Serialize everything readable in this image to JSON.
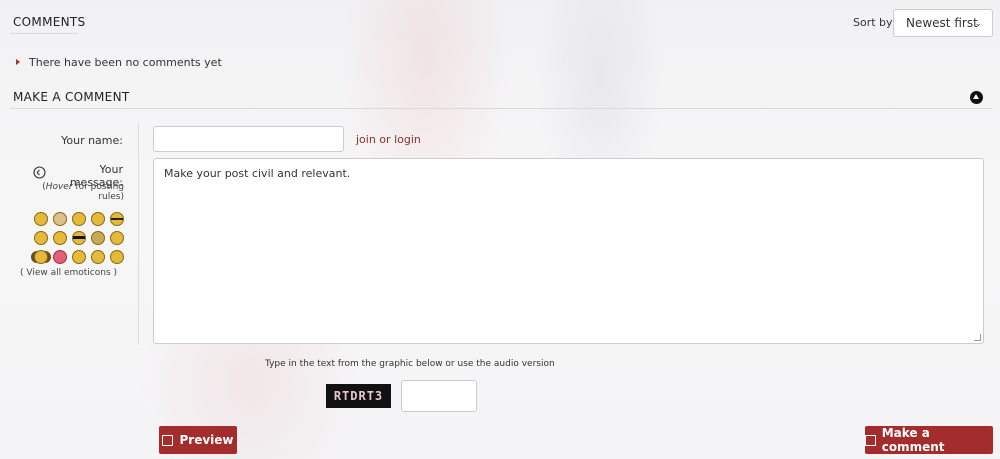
{
  "comments": {
    "title": "COMMENTS",
    "sort_label": "Sort by",
    "sort_selected": "Newest first",
    "empty_text": "There have been no comments yet"
  },
  "make_comment": {
    "title": "MAKE A COMMENT",
    "name_label": "Your name:",
    "join_text": "join or ",
    "login_text": "login",
    "message_label": "Your message:",
    "hover_word": "Hover",
    "hover_rest": " for posting rules)",
    "view_emoticons": "( View all emoticons )",
    "message_value": "Make your post civil and relevant.",
    "captcha_instruction": "Type in the text from the graphic below or use the audio version",
    "captcha_text": "RTDRT3",
    "preview_label": "Preview",
    "submit_label": "Make a comment"
  },
  "colors": {
    "accent": "#a32c2c",
    "link": "#8a2f2f"
  },
  "emoticons": [
    "smile-icon",
    "grin-icon",
    "sad-icon",
    "neutral-icon",
    "cool-icon",
    "wink-icon",
    "tongue-icon",
    "sunglasses-icon",
    "confused-icon",
    "laugh-icon",
    "headphones-icon",
    "heart-icon",
    "shocked-icon",
    "blush-icon",
    "eyeroll-icon"
  ]
}
